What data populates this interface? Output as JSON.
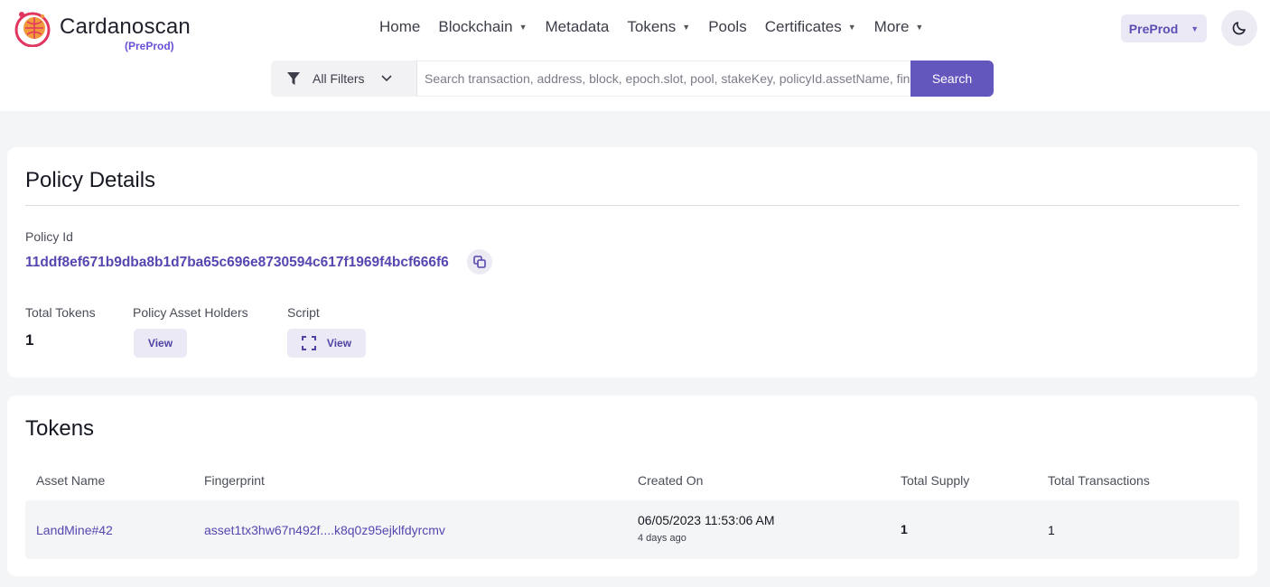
{
  "brand": {
    "name": "Cardanoscan",
    "subtitle": "(PreProd)"
  },
  "nav": {
    "home": "Home",
    "blockchain": "Blockchain",
    "metadata": "Metadata",
    "tokens": "Tokens",
    "pools": "Pools",
    "certificates": "Certificates",
    "more": "More"
  },
  "network": {
    "selected": "PreProd"
  },
  "search": {
    "filter_label": "All Filters",
    "placeholder": "Search transaction, address, block, epoch.slot, pool, stakeKey, policyId.assetName, fingerprint",
    "button_label": "Search"
  },
  "policy": {
    "title": "Policy Details",
    "policy_id_label": "Policy Id",
    "policy_id": "11ddf8ef671b9dba8b1d7ba65c696e8730594c617f1969f4bcf666f6",
    "total_tokens_label": "Total Tokens",
    "total_tokens": "1",
    "holders_label": "Policy Asset Holders",
    "holders_button": "View",
    "script_label": "Script",
    "script_button": "View"
  },
  "tokens": {
    "title": "Tokens",
    "columns": [
      "Asset Name",
      "Fingerprint",
      "Created On",
      "Total Supply",
      "Total Transactions"
    ],
    "rows": [
      {
        "asset_name": "LandMine#42",
        "fingerprint": "asset1tx3hw67n492f....k8q0z95ejklfdyrcmv",
        "created_on": "06/05/2023 11:53:06 AM",
        "created_ago": "4 days ago",
        "total_supply": "1",
        "total_transactions": "1"
      }
    ]
  },
  "colors": {
    "accent": "#6356bd",
    "link": "#5547b0",
    "background": "#f4f5f7"
  }
}
